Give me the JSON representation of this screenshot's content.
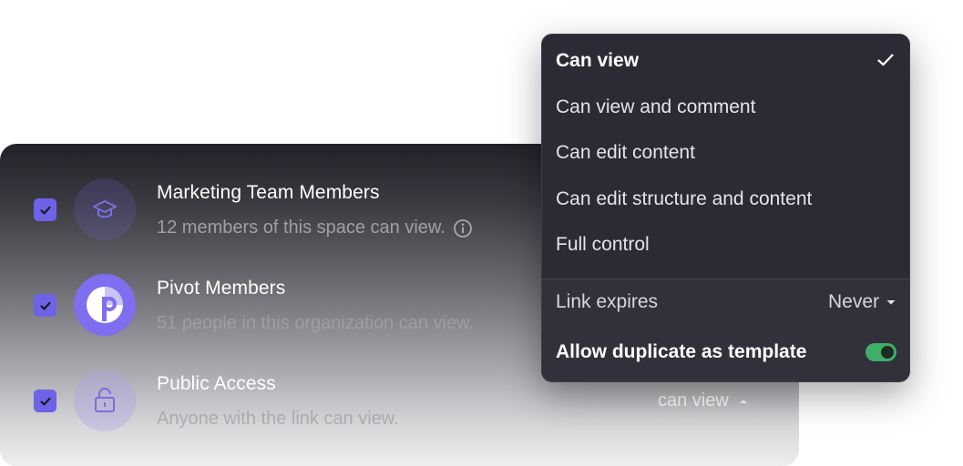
{
  "members": [
    {
      "title": "Marketing Team Members",
      "subtitle": "12 members of this space can view.",
      "checked": true,
      "icon": "graduation-cap-icon"
    },
    {
      "title": "Pivot Members",
      "subtitle": "51 people in this organization can view.",
      "checked": true,
      "icon": "pivot-logo-icon"
    },
    {
      "title": "Public Access",
      "subtitle": "Anyone with the link can view.",
      "checked": true,
      "icon": "lock-icon",
      "permission": "can view"
    }
  ],
  "menu": {
    "options": [
      "Can view",
      "Can view and comment",
      "Can edit content",
      "Can edit structure and content",
      "Full control"
    ],
    "selected": "Can view",
    "link_expires": {
      "label": "Link expires",
      "value": "Never"
    },
    "allow_duplicate": {
      "label": "Allow duplicate as template",
      "enabled": true
    }
  },
  "colors": {
    "accent": "#6d63e6",
    "menu_bg": "#2c2b35",
    "toggle_on": "#3fae68"
  }
}
